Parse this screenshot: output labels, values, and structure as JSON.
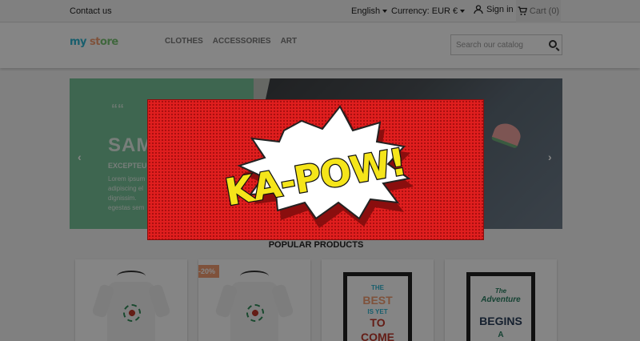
{
  "topbar": {
    "contact": "Contact us",
    "language": "English",
    "currency": "Currency: EUR €",
    "signin": "Sign in",
    "cart_label": "Cart",
    "cart_count": "(0)"
  },
  "header": {
    "logo": [
      "my",
      " st",
      "ore"
    ],
    "nav": [
      "CLOTHES",
      "ACCESSORIES",
      "ART"
    ],
    "search_placeholder": "Search our catalog"
  },
  "slider": {
    "quote": "““",
    "title": "SAM",
    "subtitle": "EXCEPTEU",
    "text": "Lorem ipsum adipiscing el dignissim. egestas sem"
  },
  "section_title": "POPULAR PRODUCTS",
  "products": [
    {
      "badge": ""
    },
    {
      "badge": "-20%"
    },
    {
      "poster_lines": [
        "THE",
        "BEST",
        "IS YET",
        "TO",
        "COME"
      ]
    },
    {
      "poster_lines": [
        "The",
        "Adventure",
        "BEGINS",
        "A"
      ]
    }
  ],
  "popup": {
    "text": "KA-POW!"
  },
  "colors": {
    "popup_bg": "#e01e1e",
    "burst": "#ffffff",
    "burst_shadow": "#8a0e0e",
    "lettering": "#f5e51a"
  }
}
